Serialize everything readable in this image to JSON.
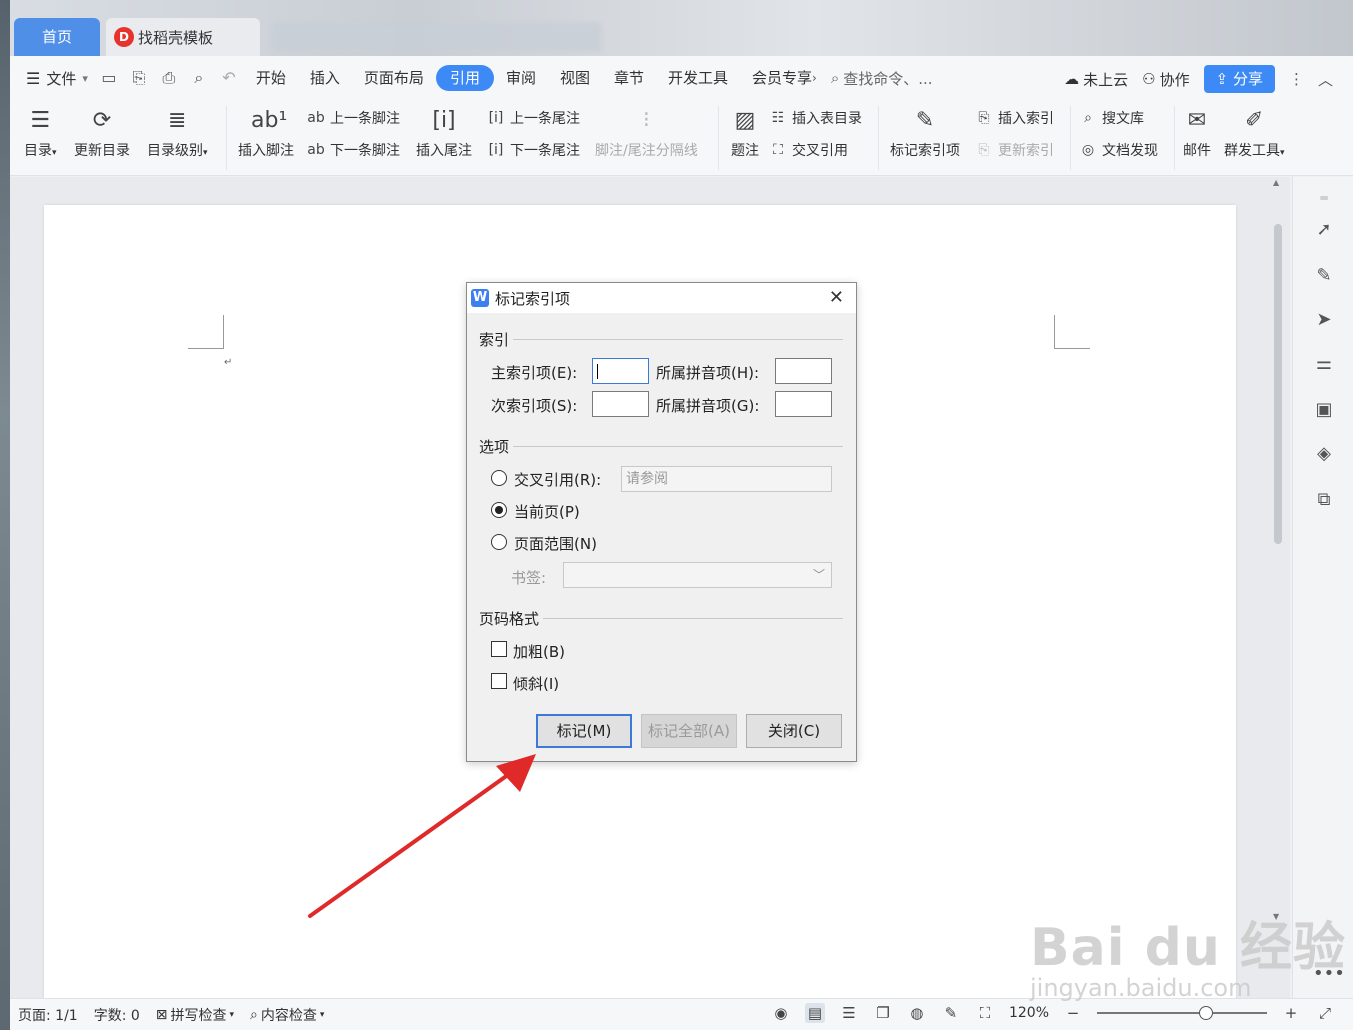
{
  "tabs": {
    "home": "首页",
    "template": "找稻壳模板"
  },
  "menubar": {
    "file": "文件",
    "items": [
      "开始",
      "插入",
      "页面布局",
      "引用",
      "审阅",
      "视图",
      "章节",
      "开发工具",
      "会员专享"
    ],
    "active": "引用",
    "search": "查找命令、...",
    "cloud": "未上云",
    "collab": "协作",
    "share": "分享"
  },
  "ribbon": {
    "toc": "目录",
    "update_toc": "更新目录",
    "toc_level": "目录级别",
    "insert_footnote": "插入脚注",
    "prev_footnote": "上一条脚注",
    "next_footnote": "下一条脚注",
    "insert_endnote": "插入尾注",
    "prev_endnote": "上一条尾注",
    "next_endnote": "下一条尾注",
    "note_separator": "脚注/尾注分隔线",
    "caption": "题注",
    "insert_table_toc": "插入表目录",
    "cross_ref": "交叉引用",
    "mark_index": "标记索引项",
    "insert_index": "插入索引",
    "update_index": "更新索引",
    "search_library": "搜文库",
    "doc_discover": "文档发现",
    "mail": "邮件",
    "group_tools": "群发工具"
  },
  "dialog": {
    "title": "标记索引项",
    "section_index": "索引",
    "main_entry_label": "主索引项(E):",
    "main_entry_value": "",
    "main_pinyin_label": "所属拼音项(H):",
    "main_pinyin_value": "",
    "sub_entry_label": "次索引项(S):",
    "sub_entry_value": "",
    "sub_pinyin_label": "所属拼音项(G):",
    "sub_pinyin_value": "",
    "section_options": "选项",
    "cross_ref_label": "交叉引用(R):",
    "cross_ref_value": "请参阅",
    "current_page_label": "当前页(P)",
    "page_range_label": "页面范围(N)",
    "bookmark_label": "书签:",
    "bookmark_value": "",
    "selected_option": "当前页(P)",
    "section_format": "页码格式",
    "bold_label": "加粗(B)",
    "bold_checked": false,
    "italic_label": "倾斜(I)",
    "italic_checked": false,
    "btn_mark": "标记(M)",
    "btn_mark_all": "标记全部(A)",
    "btn_close": "关闭(C)"
  },
  "statusbar": {
    "page": "页面: 1/1",
    "words": "字数: 0",
    "spell_check": "拼写检查",
    "content_check": "内容检查",
    "zoom": "120%",
    "zoom_level_percent": 120
  },
  "watermark": {
    "brand": "Bai du 经验",
    "url": "jingyan.baidu.com"
  },
  "colors": {
    "accent": "#3d8af7",
    "annotation_arrow": "#e02a2a"
  }
}
